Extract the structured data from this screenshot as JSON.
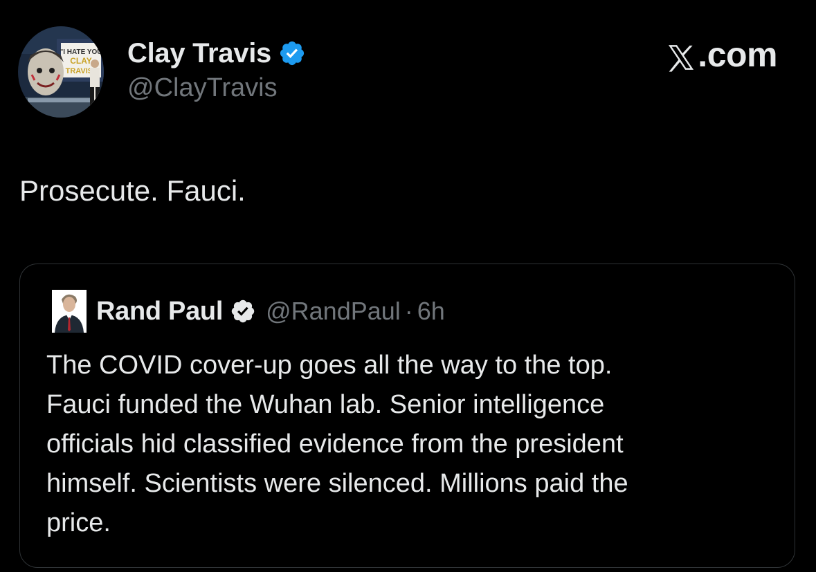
{
  "post": {
    "author": {
      "name": "Clay Travis",
      "handle": "@ClayTravis",
      "verified_icon": "verified-badge-icon",
      "avatar_text": {
        "line1": "\"I HATE YOU",
        "line2": "CLAY",
        "line3": "TRAVIS\""
      }
    },
    "brand": "X.com",
    "brand_rest": ".com",
    "text": "Prosecute. Fauci."
  },
  "quoted_post": {
    "author": {
      "name": "Rand Paul",
      "handle": "@RandPaul",
      "verified_icon": "verified-badge-icon"
    },
    "separator": "·",
    "time": "6h",
    "lines": [
      "The COVID cover-up goes all the way to the top.",
      "Fauci funded the Wuhan lab. Senior intelligence",
      "officials hid classified evidence from the president",
      "himself. Scientists were silenced. Millions paid the",
      "price."
    ]
  },
  "colors": {
    "background": "#000000",
    "primary_text": "#e7e9ea",
    "secondary_text": "#71767b",
    "verified_blue": "#1d9bf0",
    "border": "#2f3336"
  }
}
